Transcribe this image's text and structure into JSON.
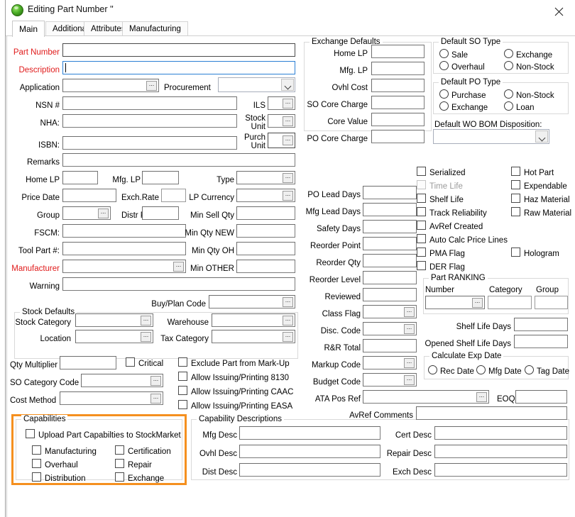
{
  "window": {
    "title": "Editing Part Number ''",
    "icon": "green-globe-icon",
    "close_label": "close-icon"
  },
  "colors": {
    "required_label": "#e01b1b",
    "highlight_box": "#F5901F",
    "focus_border": "#2b7fd4"
  },
  "tabs": [
    {
      "label": "Main",
      "active": true
    },
    {
      "label": "Additional",
      "active": false
    },
    {
      "label": "Attributes",
      "active": false
    },
    {
      "label": "Manufacturing",
      "active": false
    }
  ],
  "main": {
    "part_number": {
      "label": "Part Number",
      "value": ""
    },
    "description": {
      "label": "Description",
      "value": ""
    },
    "application": {
      "label": "Application",
      "value": ""
    },
    "procurement": {
      "label": "Procurement",
      "value": ""
    },
    "nsn": {
      "label": "NSN #",
      "value": ""
    },
    "ils": {
      "label": "ILS",
      "value": ""
    },
    "nha": {
      "label": "NHA:",
      "value": ""
    },
    "stock_unit": {
      "label_line1": "Stock",
      "label_line2": "Unit",
      "value": ""
    },
    "isbn": {
      "label": "ISBN:",
      "value": ""
    },
    "purch_unit": {
      "label_line1": "Purch",
      "label_line2": "Unit",
      "value": ""
    },
    "remarks": {
      "label": "Remarks",
      "value": ""
    },
    "home_lp": {
      "label": "Home LP",
      "value": ""
    },
    "mfg_lp": {
      "label": "Mfg. LP",
      "value": ""
    },
    "type": {
      "label": "Type",
      "value": ""
    },
    "price_date": {
      "label": "Price Date",
      "value": ""
    },
    "exch_rate": {
      "label": "Exch.Rate",
      "value": ""
    },
    "lp_currency": {
      "label": "LP Currency",
      "value": ""
    },
    "group": {
      "label": "Group",
      "value": ""
    },
    "distr_price": {
      "label": "Distr Price",
      "value": ""
    },
    "min_sell_qty": {
      "label": "Min Sell Qty",
      "value": ""
    },
    "fscm": {
      "label": "FSCM:",
      "value": ""
    },
    "min_qty_new": {
      "label": "Min Qty NEW",
      "value": ""
    },
    "tool_part": {
      "label": "Tool Part #:",
      "value": ""
    },
    "min_qty_oh": {
      "label": "Min Qty OH",
      "value": ""
    },
    "manufacturer": {
      "label": "Manufacturer",
      "value": ""
    },
    "min_other": {
      "label": "Min OTHER",
      "value": ""
    },
    "warning": {
      "label": "Warning",
      "value": ""
    },
    "buy_plan_code": {
      "label": "Buy/Plan Code",
      "value": ""
    },
    "qty_multiplier": {
      "label": "Qty Multiplier",
      "value": ""
    },
    "so_category_code": {
      "label": "SO Category Code",
      "value": ""
    },
    "cost_method": {
      "label": "Cost Method",
      "value": ""
    }
  },
  "stock_defaults": {
    "caption": "Stock Defaults",
    "stock_category": {
      "label": "Stock Category",
      "value": ""
    },
    "warehouse": {
      "label": "Warehouse",
      "value": ""
    },
    "location": {
      "label": "Location",
      "value": ""
    },
    "tax_category": {
      "label": "Tax Category",
      "value": ""
    }
  },
  "left_checkboxes": [
    {
      "label": "Critical",
      "checked": false,
      "disabled": false
    },
    {
      "label": "Exclude Part from Mark-Up",
      "checked": false,
      "disabled": false
    },
    {
      "label": "Allow Issuing/Printing 8130",
      "checked": false,
      "disabled": false
    },
    {
      "label": "Allow Issuing/Printing CAAC",
      "checked": false,
      "disabled": false
    },
    {
      "label": "Allow Issuing/Printing EASA",
      "checked": false,
      "disabled": false
    }
  ],
  "capabilities": {
    "caption": "Capabilities",
    "highlighted": true,
    "upload": {
      "label": "Upload Part Capabilties to StockMarket",
      "checked": false
    },
    "items": [
      {
        "label": "Manufacturing",
        "checked": false
      },
      {
        "label": "Certification",
        "checked": false
      },
      {
        "label": "Overhaul",
        "checked": false
      },
      {
        "label": "Repair",
        "checked": false
      },
      {
        "label": "Distribution",
        "checked": false
      },
      {
        "label": "Exchange",
        "checked": false
      }
    ]
  },
  "capability_descriptions": {
    "caption": "Capability Descriptions",
    "fields": [
      {
        "label": "Mfg Desc",
        "value": ""
      },
      {
        "label": "Cert Desc",
        "value": ""
      },
      {
        "label": "Ovhl Desc",
        "value": ""
      },
      {
        "label": "Repair Desc",
        "value": ""
      },
      {
        "label": "Dist Desc",
        "value": ""
      },
      {
        "label": "Exch Desc",
        "value": ""
      }
    ]
  },
  "exchange_defaults": {
    "caption": "Exchange Defaults",
    "fields": [
      {
        "label": "Home LP",
        "value": ""
      },
      {
        "label": "Mfg. LP",
        "value": ""
      },
      {
        "label": "Ovhl Cost",
        "value": ""
      },
      {
        "label": "SO Core Charge",
        "value": ""
      },
      {
        "label": "Core Value",
        "value": ""
      },
      {
        "label": "PO Core Charge",
        "value": ""
      }
    ]
  },
  "middle": {
    "po_lead_days": {
      "label": "PO Lead Days",
      "value": ""
    },
    "mfg_lead_days": {
      "label": "Mfg Lead Days",
      "value": ""
    },
    "safety_days": {
      "label": "Safety Days",
      "value": ""
    },
    "reorder_point": {
      "label": "Reorder Point",
      "value": ""
    },
    "reorder_qty": {
      "label": "Reorder Qty",
      "value": ""
    },
    "reorder_level": {
      "label": "Reorder Level",
      "value": ""
    },
    "reviewed": {
      "label": "Reviewed",
      "value": ""
    },
    "class_flag": {
      "label": "Class Flag",
      "value": ""
    },
    "disc_code": {
      "label": "Disc. Code",
      "value": ""
    },
    "rr_total": {
      "label": "R&R Total",
      "value": ""
    },
    "markup_code": {
      "label": "Markup Code",
      "value": ""
    },
    "budget_code": {
      "label": "Budget Code",
      "value": ""
    },
    "ata_pos_ref": {
      "label": "ATA Pos Ref",
      "value": ""
    },
    "eoq": {
      "label": "EOQ",
      "value": ""
    },
    "avref_comments": {
      "label": "AvRef Comments",
      "value": ""
    }
  },
  "default_so_type": {
    "caption": "Default SO Type",
    "options": [
      {
        "label": "Sale",
        "selected": false
      },
      {
        "label": "Exchange",
        "selected": false
      },
      {
        "label": "Overhaul",
        "selected": false
      },
      {
        "label": "Non-Stock",
        "selected": false
      }
    ]
  },
  "default_po_type": {
    "caption": "Default PO Type",
    "options": [
      {
        "label": "Purchase",
        "selected": false
      },
      {
        "label": "Non-Stock",
        "selected": false
      },
      {
        "label": "Exchange",
        "selected": false
      },
      {
        "label": "Loan",
        "selected": false
      }
    ]
  },
  "default_wo_bom": {
    "label": "Default WO BOM Disposition:",
    "value": ""
  },
  "right_checkboxes": [
    {
      "label": "Serialized",
      "checked": false,
      "disabled": false
    },
    {
      "label": "Hot Part",
      "checked": false,
      "disabled": false
    },
    {
      "label": "Time Life",
      "checked": false,
      "disabled": true
    },
    {
      "label": "Expendable",
      "checked": false,
      "disabled": false
    },
    {
      "label": "Shelf Life",
      "checked": false,
      "disabled": false
    },
    {
      "label": "Haz Material",
      "checked": false,
      "disabled": false
    },
    {
      "label": "Track Reliability",
      "checked": false,
      "disabled": false
    },
    {
      "label": "Raw Material",
      "checked": false,
      "disabled": false
    },
    {
      "label": "AvRef Created",
      "checked": false,
      "disabled": false
    },
    {
      "label": "Auto Calc Price Lines",
      "checked": false,
      "disabled": false
    },
    {
      "label": "PMA Flag",
      "checked": false,
      "disabled": false
    },
    {
      "label": "Hologram",
      "checked": false,
      "disabled": false
    },
    {
      "label": "DER Flag",
      "checked": false,
      "disabled": false
    }
  ],
  "part_ranking": {
    "caption": "Part RANKING",
    "number": {
      "label": "Number",
      "value": ""
    },
    "category": {
      "label": "Category",
      "value": ""
    },
    "group": {
      "label": "Group",
      "value": ""
    }
  },
  "shelf_life_days": {
    "label": "Shelf Life Days",
    "value": ""
  },
  "opened_shelf_life_days": {
    "label": "Opened Shelf Life Days",
    "value": ""
  },
  "calculate_exp_date": {
    "caption": "Calculate Exp Date",
    "options": [
      {
        "label": "Rec Date",
        "selected": false
      },
      {
        "label": "Mfg Date",
        "selected": false
      },
      {
        "label": "Tag Date",
        "selected": false
      }
    ]
  }
}
